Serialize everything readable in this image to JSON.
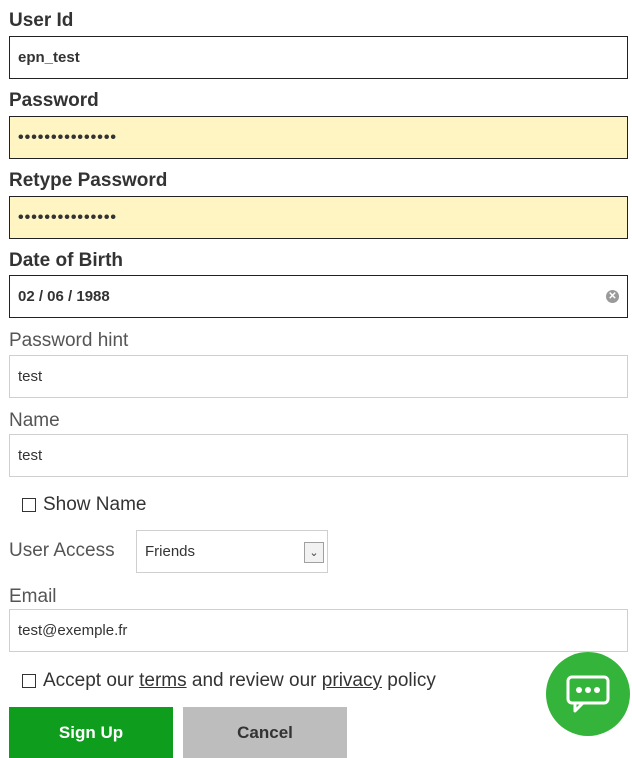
{
  "form": {
    "user_id": {
      "label": "User Id",
      "value": "epn_test"
    },
    "password": {
      "label": "Password",
      "masked": "•••••••••••••••"
    },
    "retype_password": {
      "label": "Retype Password",
      "masked": "•••••••••••••••"
    },
    "dob": {
      "label": "Date of Birth",
      "value": "02 / 06 / 1988"
    },
    "password_hint": {
      "label": "Password hint",
      "value": "test"
    },
    "name": {
      "label": "Name",
      "value": "test"
    },
    "show_name": {
      "label": "Show Name",
      "checked": false
    },
    "user_access": {
      "label": "User Access",
      "selected": "Friends"
    },
    "email": {
      "label": "Email",
      "value": "test@exemple.fr"
    },
    "terms": {
      "checked": false,
      "prefix": "Accept our",
      "terms_link": "terms",
      "middle": "and review our",
      "privacy_link": "privacy",
      "suffix": "policy"
    }
  },
  "buttons": {
    "signup": "Sign Up",
    "cancel": "Cancel"
  },
  "chat": {
    "icon": "chat-bubble-icon",
    "color": "#34b43a"
  },
  "colors": {
    "signup": "#0f9d1e",
    "cancel": "#bdbdbd",
    "autofill": "#fff5c2"
  }
}
